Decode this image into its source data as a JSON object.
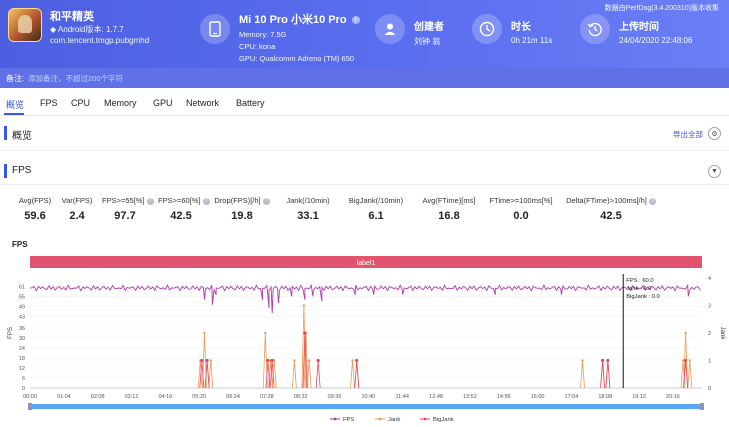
{
  "header": {
    "note": "数据由PerfDog(3.4.200310)版本收集",
    "game": {
      "name": "和平精英",
      "android": "◆ Android版本: 1.7.7",
      "package": "com.tencent.tmgp.pubgmhd"
    },
    "device": {
      "title": "Mi 10 Pro 小米10 Pro",
      "memory": "Memory: 7.5G",
      "cpu": "CPU: kona",
      "gpu": "GPU: Qualcomm Adreno (TM) 650"
    },
    "creator": {
      "label": "创建者",
      "value": "刘钟 翁"
    },
    "duration": {
      "label": "时长",
      "value": "0h 21m 11s"
    },
    "upload": {
      "label": "上传时间",
      "value": "24/04/2020 22:48:06"
    }
  },
  "remark": {
    "label": "备注:",
    "placeholder": "添加备注，不超过200个字符"
  },
  "tabs": [
    "概览",
    "FPS",
    "CPU",
    "Memory",
    "GPU",
    "Network",
    "Battery"
  ],
  "overview": {
    "title": "概览",
    "export": "导出全部"
  },
  "fps_section": {
    "title": "FPS",
    "stats": [
      {
        "label": "Avg(FPS)",
        "value": "59.6"
      },
      {
        "label": "Var(FPS)",
        "value": "2.4"
      },
      {
        "label": "FPS>=55[%]",
        "value": "97.7"
      },
      {
        "label": "FPS>=60[%]",
        "value": "42.5"
      },
      {
        "label": "Drop(FPS)[/h]",
        "value": "19.8"
      },
      {
        "label": "Jank(/10min)",
        "value": "33.1"
      },
      {
        "label": "BigJank(/10min)",
        "value": "6.1"
      },
      {
        "label": "Avg(FTime)[ms]",
        "value": "16.8"
      },
      {
        "label": "FTime>=100ms[%]",
        "value": "0.0"
      },
      {
        "label": "Delta(FTime)>100ms[/h]",
        "value": "42.5"
      }
    ]
  },
  "colors": {
    "accent": "#3a56e4",
    "fps": "#b03aa8",
    "jank": "#ef9a55",
    "bigjank": "#e8475f",
    "label_band": "#e2546e"
  },
  "chart_data": {
    "type": "line",
    "title": "FPS",
    "band_label": "label1",
    "ylabel": "FPS",
    "y2label": "Jank",
    "ylim": [
      0,
      66
    ],
    "y2lim": [
      0,
      4
    ],
    "yticks": [
      0,
      6,
      12,
      18,
      24,
      30,
      36,
      43,
      49,
      55,
      61
    ],
    "y2ticks": [
      0,
      1,
      2,
      3,
      4
    ],
    "xticks": [
      "00:00",
      "01:04",
      "02:08",
      "03:12",
      "04:16",
      "05:20",
      "06:24",
      "07:28",
      "08:32",
      "09:36",
      "10:40",
      "11:44",
      "12:48",
      "13:52",
      "14:56",
      "16:00",
      "17:04",
      "18:08",
      "19:12",
      "20:16"
    ],
    "duration_s": 1271,
    "fps_baseline": 60,
    "fps_dips": [
      {
        "t": 330,
        "fps": 53
      },
      {
        "t": 345,
        "fps": 50
      },
      {
        "t": 352,
        "fps": 56
      },
      {
        "t": 440,
        "fps": 53
      },
      {
        "t": 452,
        "fps": 48
      },
      {
        "t": 458,
        "fps": 45
      },
      {
        "t": 470,
        "fps": 51
      },
      {
        "t": 495,
        "fps": 55
      },
      {
        "t": 520,
        "fps": 53
      },
      {
        "t": 535,
        "fps": 55
      },
      {
        "t": 552,
        "fps": 52
      },
      {
        "t": 615,
        "fps": 56
      },
      {
        "t": 650,
        "fps": 56
      },
      {
        "t": 705,
        "fps": 56
      },
      {
        "t": 880,
        "fps": 56
      },
      {
        "t": 1005,
        "fps": 56
      },
      {
        "t": 1245,
        "fps": 55
      }
    ],
    "jank": [
      {
        "t": 322,
        "v": 1
      },
      {
        "t": 330,
        "v": 2
      },
      {
        "t": 335,
        "v": 1
      },
      {
        "t": 342,
        "v": 1
      },
      {
        "t": 445,
        "v": 2
      },
      {
        "t": 455,
        "v": 1
      },
      {
        "t": 462,
        "v": 1
      },
      {
        "t": 500,
        "v": 1
      },
      {
        "t": 518,
        "v": 3
      },
      {
        "t": 522,
        "v": 2
      },
      {
        "t": 528,
        "v": 1
      },
      {
        "t": 610,
        "v": 1
      },
      {
        "t": 618,
        "v": 1
      },
      {
        "t": 1045,
        "v": 1
      },
      {
        "t": 1083,
        "v": 1
      },
      {
        "t": 1093,
        "v": 1
      },
      {
        "t": 1235,
        "v": 1
      },
      {
        "t": 1240,
        "v": 2
      },
      {
        "t": 1248,
        "v": 1
      }
    ],
    "bigjank": [
      {
        "t": 325,
        "v": 1
      },
      {
        "t": 335,
        "v": 1
      },
      {
        "t": 450,
        "v": 1
      },
      {
        "t": 458,
        "v": 1
      },
      {
        "t": 520,
        "v": 2
      },
      {
        "t": 545,
        "v": 1
      },
      {
        "t": 618,
        "v": 1
      },
      {
        "t": 1083,
        "v": 1
      },
      {
        "t": 1093,
        "v": 1
      },
      {
        "t": 1240,
        "v": 1
      }
    ],
    "cursor": {
      "t": 1122,
      "lines": [
        "FPS : 60.0",
        "Jank : 0.0",
        "BigJank : 0.0"
      ]
    },
    "legend": [
      "FPS",
      "Jank",
      "BigJank"
    ]
  }
}
